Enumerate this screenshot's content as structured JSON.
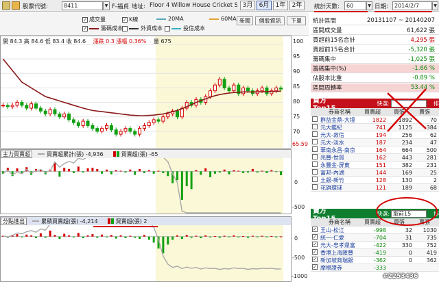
{
  "toolbar": {
    "code_label": "股票代號:",
    "code_value": "8411",
    "company": "F-福貞",
    "address_label": "地址:",
    "address_value": "Floor 4  Willow House  Cricket Square",
    "period_buttons": [
      "3月",
      "6月",
      "1年",
      "2年"
    ],
    "days_label": "統計天數:",
    "days_value": "60",
    "date_label": "日期:",
    "date_value": "2014/2/7"
  },
  "legend": {
    "row1": [
      "成交量",
      "K線",
      "20MA",
      "60MA"
    ],
    "row2": [
      "籌碼成本",
      "外資成本",
      "投信成本"
    ],
    "buttons": [
      "新聞",
      "個股資訊",
      "下單"
    ]
  },
  "ohlc": {
    "text": "開 84.3  高 84.6  低 83.4  收 84.6",
    "change": "漲跌 0.3  漲幅 0.36%",
    "volume": "量 675"
  },
  "pane2": {
    "selector": "主力買賣超",
    "legend1": "買賣超累計(張) -4,936",
    "legend2": "買賣超(張) -65"
  },
  "pane3": {
    "selector": "分點進出",
    "legend1": "累積買賣超(張) -4,214",
    "legend2": "買賣超(張) 2"
  },
  "axis": {
    "price_ticks": [
      "100",
      "95",
      "90",
      "85",
      "80",
      "75",
      "70"
    ],
    "price_last": "65.59",
    "p2_ticks": [
      "0",
      "-500"
    ],
    "p3_ticks": [
      "0",
      "-500",
      "-1000"
    ]
  },
  "stats": [
    {
      "k": "統計區間",
      "v": "20131107 ~ 20140207"
    },
    {
      "k": "區間成交量",
      "v": "61,622 張"
    },
    {
      "k": "買超前15名合計",
      "v": "4,295 張"
    },
    {
      "k": "賣超前15名合計",
      "v": "-5,320 張"
    },
    {
      "k": "籌碼集中",
      "v": "-1,025 張"
    },
    {
      "k": "籌碼集中(%)",
      "v": "-1.66 %"
    },
    {
      "k": "佔股本比重",
      "v": "-0.89 %"
    },
    {
      "k": "區間周轉率",
      "v": "53.44 %"
    }
  ],
  "buy_section": {
    "title": "買方Top15",
    "filter_label": "快選:",
    "filter_value": "",
    "sort_label": "排",
    "headers": [
      "券商名稱",
      "買賣超",
      "買張",
      "賣張"
    ],
    "rows": [
      [
        "群益金鼎-大境",
        "1822",
        "1892",
        "70"
      ],
      [
        "元大鑑紀",
        "741",
        "1125",
        "384"
      ],
      [
        "元大-敦信",
        "194",
        "256",
        "62"
      ],
      [
        "元大-淡水",
        "187",
        "234",
        "47"
      ],
      [
        "華南永昌-南京",
        "164",
        "664",
        "500"
      ],
      [
        "兆豐-世貿",
        "162",
        "443",
        "281"
      ],
      [
        "永豐金-屏東",
        "151",
        "382",
        "231"
      ],
      [
        "富邦-內湖",
        "144",
        "169",
        "25"
      ],
      [
        "土銀-新竹",
        "128",
        "130",
        "2"
      ],
      [
        "花旗環球",
        "121",
        "189",
        "68"
      ]
    ]
  },
  "sell_section": {
    "title": "賣方Top15",
    "filter_label": "快選:",
    "filter_value": "取前15",
    "sort_label": "排",
    "headers": [
      "券商名稱",
      "買賣超",
      "買張",
      "賣張"
    ],
    "rows": [
      [
        "王山-松江",
        "-998",
        "32",
        "1030"
      ],
      [
        "統一-仁愛",
        "-704",
        "31",
        "735"
      ],
      [
        "元大-忠孝鼎富",
        "-422",
        "330",
        "752"
      ],
      [
        "香港上海匯豐",
        "-419",
        "0",
        "419"
      ],
      [
        "新加坡商瑞銀",
        "-362",
        "0",
        "362"
      ],
      [
        "摩根證券",
        "-333",
        "",
        ""
      ]
    ]
  },
  "watermark": "#2253436",
  "colors": {
    "up": "#d40000",
    "down": "#13a013",
    "cost_line": "#8b1a1a",
    "sec_red": "#c4101a",
    "sec_green": "#0f7f2f",
    "highlight_bg": "#fbf8d8",
    "annotation": "#d40000"
  },
  "chart_data": [
    {
      "type": "bar",
      "role": "price-volume",
      "ylim": [
        65,
        100
      ],
      "close": [
        79,
        78.5,
        79,
        80,
        79,
        78,
        79.5,
        78,
        77,
        76,
        77.5,
        76,
        75,
        76,
        74,
        73,
        72,
        73.5,
        72,
        71,
        70,
        71,
        72,
        70.5,
        69,
        70,
        71,
        70,
        69,
        71,
        72,
        73,
        74,
        73.5,
        75,
        76,
        77,
        75,
        78,
        80,
        79,
        81,
        80,
        82,
        84,
        86,
        88,
        85,
        84,
        86,
        83,
        85,
        84,
        83,
        84,
        85,
        83,
        84,
        85,
        84.6
      ],
      "cost": [
        95,
        93,
        91,
        89,
        87,
        86,
        85,
        84,
        83,
        82,
        81.5,
        81,
        80.5,
        80,
        79.5,
        79,
        78.5,
        78,
        77.6,
        77.2,
        77,
        76.8,
        76.6,
        76.4,
        76.2,
        76,
        75.8,
        75.6,
        75.5,
        75.4,
        75.4,
        75.5,
        75.6,
        75.8,
        76,
        76.4,
        76.8,
        77.2,
        77.8,
        78.5,
        79.2,
        80,
        80.6,
        81.2,
        81.8,
        82.3,
        82.7,
        83,
        83.2,
        83.4,
        83.5,
        83.6,
        83.6,
        83.6,
        83.6,
        83.7,
        83.7,
        83.8,
        83.8,
        83.9
      ]
    },
    {
      "type": "bar",
      "role": "main-force-net",
      "ylim": [
        -700,
        200
      ],
      "values": [
        -40,
        60,
        -80,
        50,
        -30,
        70,
        -60,
        40,
        20,
        -50,
        30,
        150,
        -90,
        60,
        40,
        -30,
        80,
        -20,
        50,
        60,
        40,
        -40,
        30,
        -50,
        20,
        10,
        -20,
        30,
        -60,
        40,
        -30,
        20,
        -40,
        10,
        -30,
        -80,
        -200,
        -150,
        -480,
        -250,
        -300,
        20,
        -60,
        50,
        -100,
        -40,
        -20,
        30,
        -50,
        20,
        10,
        -30,
        -20,
        40,
        -20,
        10,
        -30,
        20,
        -10,
        -65
      ],
      "cum": [
        -40,
        20,
        -60,
        -10,
        -40,
        30,
        -30,
        10,
        30,
        -20,
        10,
        160,
        70,
        130,
        170,
        140,
        220,
        200,
        250,
        310,
        350,
        310,
        340,
        290,
        310,
        320,
        300,
        330,
        270,
        310,
        280,
        300,
        260,
        270,
        240,
        160,
        -40,
        -190,
        -670,
        -920,
        -1220,
        -1200,
        -1260,
        -1210,
        -1310,
        -1350,
        -1370,
        -1340,
        -1390,
        -1370,
        -1360,
        -1390,
        -1410,
        -1370,
        -1390,
        -1380,
        -1410,
        -1390,
        -1400,
        -1465
      ]
    },
    {
      "type": "bar",
      "role": "branch-net",
      "ylim": [
        -1100,
        250
      ],
      "values": [
        20,
        -30,
        40,
        60,
        -20,
        50,
        30,
        -40,
        80,
        -30,
        150,
        40,
        -60,
        70,
        30,
        -20,
        90,
        -40,
        30,
        60,
        -30,
        50,
        -20,
        40,
        -50,
        30,
        -40,
        20,
        -30,
        -60,
        40,
        -80,
        -150,
        -300,
        -420,
        -200,
        -80,
        30,
        -60,
        40,
        -30,
        20,
        -40,
        30,
        -20,
        10,
        -30,
        20,
        -10,
        30,
        -20,
        10,
        -30,
        20,
        -10,
        20,
        -10,
        10,
        -20,
        2
      ],
      "cum": [
        20,
        -10,
        30,
        90,
        70,
        120,
        150,
        110,
        190,
        160,
        310,
        350,
        290,
        360,
        390,
        370,
        460,
        420,
        450,
        510,
        480,
        530,
        510,
        550,
        500,
        530,
        490,
        510,
        480,
        420,
        460,
        380,
        230,
        -70,
        -490,
        -690,
        -770,
        -740,
        -800,
        -760,
        -790,
        -770,
        -810,
        -780,
        -800,
        -790,
        -820,
        -800,
        -810,
        -780,
        -800,
        -790,
        -820,
        -800,
        -810,
        -790,
        -800,
        -790,
        -810,
        -808
      ]
    }
  ]
}
